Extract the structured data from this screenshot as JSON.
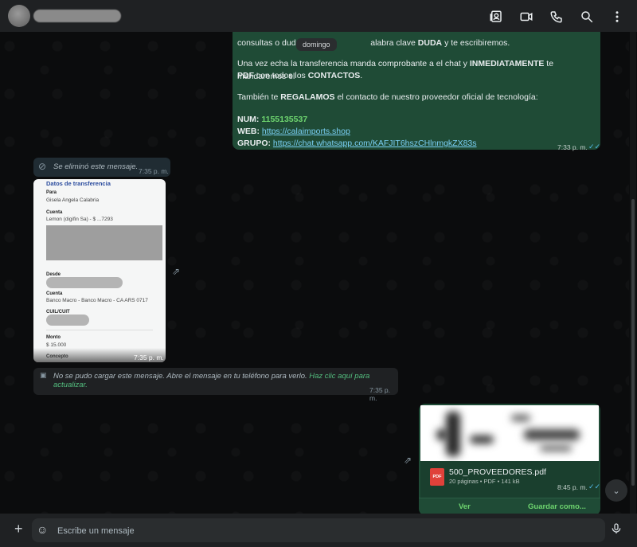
{
  "header": {
    "icons": [
      "contacts-icon",
      "video-call-icon",
      "voice-call-icon",
      "search-icon",
      "menu-icon"
    ]
  },
  "date_pill": "domingo",
  "outgoing": {
    "line1_a": "consultas o duda",
    "line1_b": "alabra clave",
    "line1_bold": "DUDA",
    "line1_c": "y te escribiremos.",
    "line2_a": "Una vez echa la transferencia manda comprobante a el chat y",
    "line2_bold": "INMEDIATAMENTE",
    "line2_c": "te mandaremos el",
    "line3_bold1": "PDF",
    "line3_a": "con todos los",
    "line3_bold2": "CONTACTOS",
    "line3_end": ".",
    "line4_a": "También te",
    "line4_bold": "REGALAMOS",
    "line4_c": "el contacto de nuestro proveedor oficial de tecnología:",
    "num_label": "NUM:",
    "num_value": "1155135537",
    "web_label": "WEB:",
    "web_value": "https://calaimports.shop",
    "grupo_label": "GRUPO:",
    "grupo_value": "https://chat.whatsapp.com/KAFJIT6hszCHlnmgkZX83s",
    "time": "7:33 p. m."
  },
  "deleted": {
    "text": "Se eliminó este mensaje.",
    "time": "7:35 p. m."
  },
  "transfer": {
    "title": "Datos de transferencia",
    "para_label": "Para",
    "para_value": "Gisela Angela Calabria",
    "cuenta_label": "Cuenta",
    "cuenta_value": "Lemon (digifin Sa) - $ ...7293",
    "desde_label": "Desde",
    "cuenta2_label": "Cuenta",
    "cuenta2_value": "Banco Macro - Banco Macro - CA ARS 0717",
    "cuil_label": "CUIL/CUIT",
    "monto_label": "Monto",
    "monto_value": "$ 15.000",
    "concepto_label": "Concepto",
    "time": "7:35 p. m."
  },
  "failed": {
    "text": "No se pudo cargar este mensaje. Abre el mensaje en tu teléfono para verlo.",
    "link": "Haz clic aquí para actualizar.",
    "time": "7:35 p. m."
  },
  "document": {
    "file_name": "500_PROVEEDORES.pdf",
    "meta": "20 páginas • PDF • 141 kB",
    "badge": "PDF",
    "time": "8:45 p. m.",
    "view": "Ver",
    "save": "Guardar como..."
  },
  "footer": {
    "placeholder": "Escribe un mensaje"
  }
}
